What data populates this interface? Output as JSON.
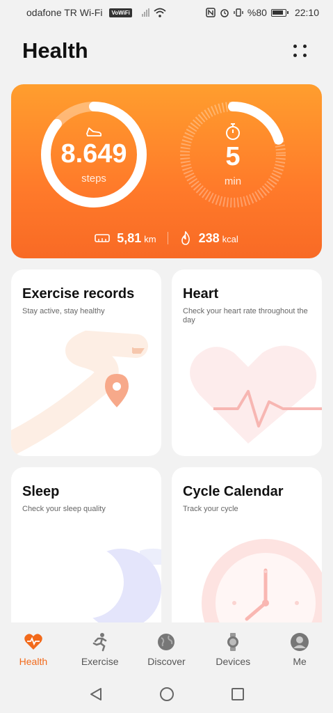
{
  "status_bar": {
    "carrier": "odafone TR Wi-Fi",
    "vowifi": "VoWiFi",
    "battery": "%80",
    "time": "22:10"
  },
  "header": {
    "title": "Health",
    "more_icon": "more-grid-icon"
  },
  "activity": {
    "steps_value": "8.649",
    "steps_unit": "steps",
    "steps_progress": 0.86,
    "minutes_value": "5",
    "minutes_unit": "min",
    "minutes_progress": 0.2,
    "distance_value": "5,81",
    "distance_unit": "km",
    "calories_value": "238",
    "calories_unit": "kcal",
    "accent": "#ff8a2b"
  },
  "tiles": {
    "exercise": {
      "title": "Exercise records",
      "subtitle": "Stay active, stay healthy"
    },
    "heart": {
      "title": "Heart",
      "subtitle": "Check your heart rate throughout the day"
    },
    "sleep": {
      "title": "Sleep",
      "subtitle": "Check your sleep quality"
    },
    "cycle": {
      "title": "Cycle Calendar",
      "subtitle": "Track your cycle"
    }
  },
  "nav": {
    "items": [
      {
        "label": "Health",
        "icon": "heart-pulse-icon",
        "active": true
      },
      {
        "label": "Exercise",
        "icon": "running-person-icon",
        "active": false
      },
      {
        "label": "Discover",
        "icon": "globe-icon",
        "active": false
      },
      {
        "label": "Devices",
        "icon": "watch-icon",
        "active": false
      },
      {
        "label": "Me",
        "icon": "user-avatar-icon",
        "active": false
      }
    ]
  }
}
